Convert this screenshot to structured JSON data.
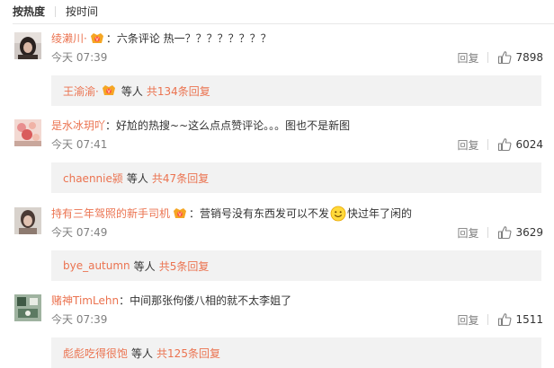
{
  "sort": {
    "hot_label": "按热度",
    "time_label": "按时间"
  },
  "comments": [
    {
      "username": "绫濑川·",
      "vip": true,
      "colon": "：",
      "text": "六条评论 热一？？？？？？？？",
      "emoji_after": null,
      "text_after": "",
      "time": "今天 07:39",
      "reply_label": "回复",
      "likes": "7898",
      "reply_box": {
        "user": "王渝渝·",
        "user_vip": true,
        "etc": "等人",
        "total_prefix": "共",
        "total": "134",
        "total_suffix": "条回复"
      }
    },
    {
      "username": "是水冰玥吖",
      "vip": false,
      "colon": "：",
      "text": "好尬的热搜~~这么点点赞评论。。。图也不是新图",
      "emoji_after": null,
      "text_after": "",
      "time": "今天 07:41",
      "reply_label": "回复",
      "likes": "6024",
      "reply_box": {
        "user": "chaennie颍",
        "user_vip": false,
        "etc": "等人",
        "total_prefix": "共",
        "total": "47",
        "total_suffix": "条回复"
      }
    },
    {
      "username": "持有三年驾照的新手司机",
      "vip": true,
      "colon": "：",
      "text": "营销号没有东西发可以不发",
      "emoji_after": "smile-emoji",
      "text_after": "快过年了闲的",
      "time": "今天 07:49",
      "reply_label": "回复",
      "likes": "3629",
      "reply_box": {
        "user": "bye_autumn",
        "user_vip": false,
        "etc": "等人",
        "total_prefix": "共",
        "total": "5",
        "total_suffix": "条回复"
      }
    },
    {
      "username": "赌神TimLehn",
      "vip": false,
      "colon": "：",
      "text": "中间那张佝偻八相的就不太李姐了",
      "emoji_after": null,
      "text_after": "",
      "time": "今天 07:39",
      "reply_label": "回复",
      "likes": "1511",
      "reply_box": {
        "user": "彪彪吃得很饱",
        "user_vip": false,
        "etc": "等人",
        "total_prefix": "共",
        "total": "125",
        "total_suffix": "条回复"
      }
    }
  ],
  "colors": {
    "username": "#eb7350",
    "text": "#333333",
    "meta": "#808080",
    "reply_box_bg": "#f2f2f2"
  }
}
